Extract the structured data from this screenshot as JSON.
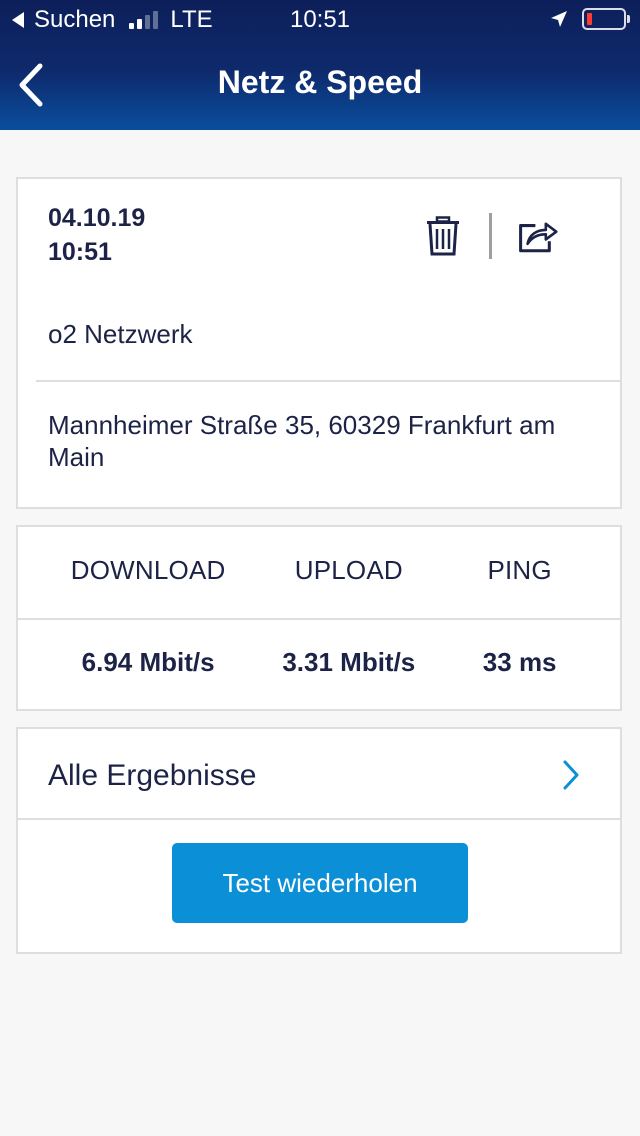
{
  "status_bar": {
    "back_app": "Suchen",
    "network_type": "LTE",
    "time": "10:51",
    "battery_color": "#ff3b30"
  },
  "nav": {
    "title": "Netz & Speed",
    "back_icon": "chevron-left-icon"
  },
  "measurement": {
    "date": "04.10.19",
    "time": "10:51",
    "network": "o2 Netzwerk",
    "address": "Mannheimer Straße 35, 60329 Frankfurt am Main",
    "actions": [
      "trash-icon",
      "share-icon"
    ]
  },
  "stats": {
    "download_label": "DOWNLOAD",
    "upload_label": "UPLOAD",
    "ping_label": "PING",
    "download_value": "6.94 Mbit/s",
    "upload_value": "3.31 Mbit/s",
    "ping_value": "33 ms"
  },
  "results": {
    "all_results_label": "Alle Ergebnisse",
    "repeat_button": "Test wiederholen"
  },
  "colors": {
    "header_top": "#0d1f5a",
    "header_bottom": "#0a4e9e",
    "accent": "#0b8fd6",
    "text": "#1c2346"
  }
}
